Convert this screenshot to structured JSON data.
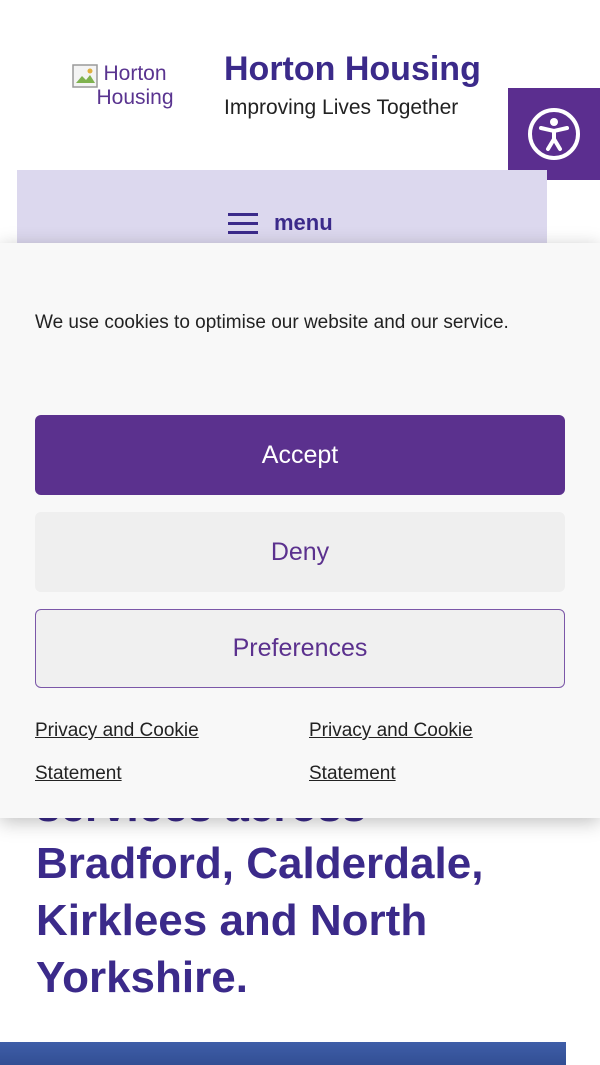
{
  "header": {
    "logo_alt": "Horton Housing",
    "title": "Horton Housing",
    "tagline": "Improving Lives Together",
    "accessibility_icon": "accessibility-person-icon"
  },
  "nav": {
    "menu_icon": "hamburger-icon",
    "menu_label": "menu"
  },
  "hero": {
    "text": "services across Bradford, Calderdale, Kirklees and North Yorkshire."
  },
  "cookie_banner": {
    "message": "We use cookies to optimise our website and our service.",
    "accept_label": "Accept",
    "deny_label": "Deny",
    "preferences_label": "Preferences",
    "links": [
      {
        "label": "Privacy and Cookie Statement"
      },
      {
        "label": "Privacy and Cookie Statement"
      }
    ]
  },
  "colors": {
    "brand_purple": "#5b318e",
    "heading_purple": "#3b2a8a",
    "nav_background": "#dcd8ee"
  }
}
